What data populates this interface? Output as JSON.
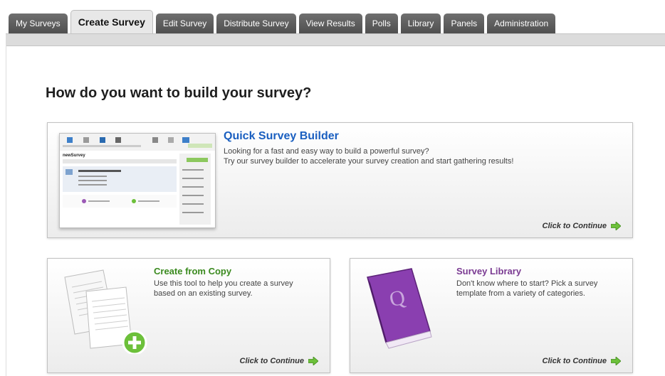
{
  "tabs": [
    {
      "label": "My Surveys"
    },
    {
      "label": "Create Survey",
      "active": true
    },
    {
      "label": "Edit Survey"
    },
    {
      "label": "Distribute Survey"
    },
    {
      "label": "View Results"
    },
    {
      "label": "Polls"
    },
    {
      "label": "Library"
    },
    {
      "label": "Panels"
    },
    {
      "label": "Administration"
    }
  ],
  "page": {
    "title": "How do you want to build your survey?"
  },
  "cards": {
    "quick": {
      "title": "Quick Survey Builder",
      "desc1": "Looking for a fast and easy way to build a powerful survey?",
      "desc2": "Try our survey builder to accelerate your survey creation and start gathering results!",
      "continue": "Click to Continue",
      "thumb_survey_name": "newSurvey",
      "color": "#1a5fc0"
    },
    "copy": {
      "title": "Create from Copy",
      "desc1": "Use this tool to help you create a survey",
      "desc2": "based on an existing survey.",
      "continue": "Click to Continue",
      "icon": "documents-copy-icon",
      "color": "#3a8a1e"
    },
    "library": {
      "title": "Survey Library",
      "desc1": "Don't know where to start? Pick a survey",
      "desc2": "template from a variety of categories.",
      "continue": "Click to Continue",
      "book_letter": "Q",
      "icon": "purple-book-icon",
      "color": "#7a3a92"
    }
  },
  "colors": {
    "accent_arrow": "#6cc03a",
    "tab_dark": "#585858"
  }
}
